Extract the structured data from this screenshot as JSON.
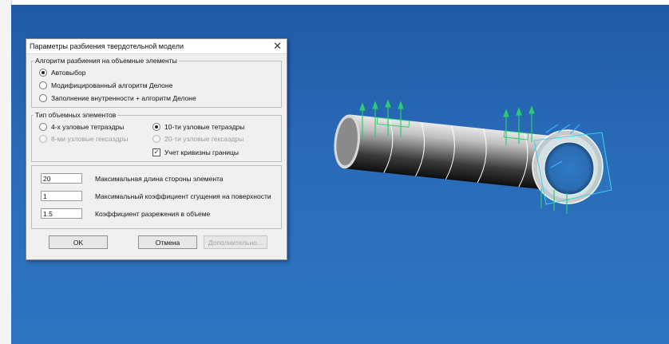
{
  "dialog": {
    "title": "Параметры разбиения твердотельной модели",
    "close_symbol": "✕",
    "algorithm_group": {
      "legend": "Алгоритм разбиения на объемные элементы",
      "options": [
        "Автовыбор",
        "Модифицированный алгоритм Делоне",
        "Заполнение внутренности + алгоритм Делоне"
      ],
      "selected": "Автовыбор"
    },
    "element_type_group": {
      "legend": "Тип объемных элементов",
      "tetra4": "4-х узловые тетраэдры",
      "hexa8": "8-ми узловые гексаэдры",
      "tetra10": "10-ти узловые тетраэдры",
      "hexa20": "20-ти узловые гексаэдры",
      "selected": "10-ти узловые тетраэдры",
      "curvature_checkbox": "Учет кривизны границы",
      "curvature_checked": true
    },
    "params": {
      "max_side_value": "20",
      "max_side_label": "Максимальная длина стороны элемента",
      "max_coeff_value": "1",
      "max_coeff_label": "Максимальный коэффициент сгущения на поверхности",
      "rarefaction_value": "1.5",
      "rarefaction_label": "Коэффициент разрежения в объеме"
    },
    "buttons": {
      "ok": "OK",
      "cancel": "Отмена",
      "more": "Дополнительно..."
    }
  },
  "colors": {
    "viewport_top": "#1f5aa6",
    "viewport_bottom": "#2d74c2",
    "arrows": "#2ecc71",
    "selection": "#3fd0f0"
  },
  "model": {
    "object": "pipe-segment",
    "arrow_icon": "load-arrow-icon"
  }
}
